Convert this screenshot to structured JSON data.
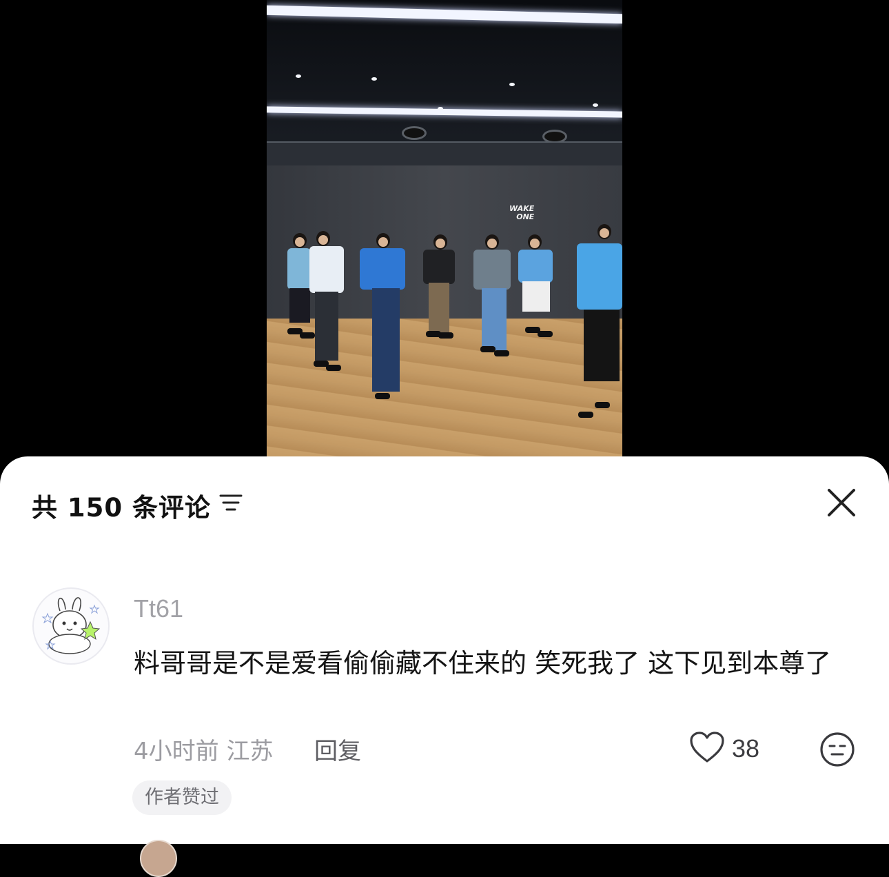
{
  "video": {
    "wall_logo_line1": "WAKE",
    "wall_logo_line2": "ONE"
  },
  "comments_panel": {
    "title": "共 150 条评论",
    "sort_icon": "sort-lines-icon",
    "close_icon": "close-icon"
  },
  "comment": {
    "username": "Tt61",
    "text": "料哥哥是不是爱看偷偷藏不住来的 笑死我了 这下见到本尊了",
    "time": "4小时前",
    "location": "江苏",
    "time_location": "4小时前 江苏",
    "reply_label": "回复",
    "like_count": "38",
    "badge": "作者赞过",
    "avatar_icon": "bunny-avatar-icon",
    "like_icon": "heart-outline-icon",
    "dislike_icon": "meh-face-icon"
  }
}
